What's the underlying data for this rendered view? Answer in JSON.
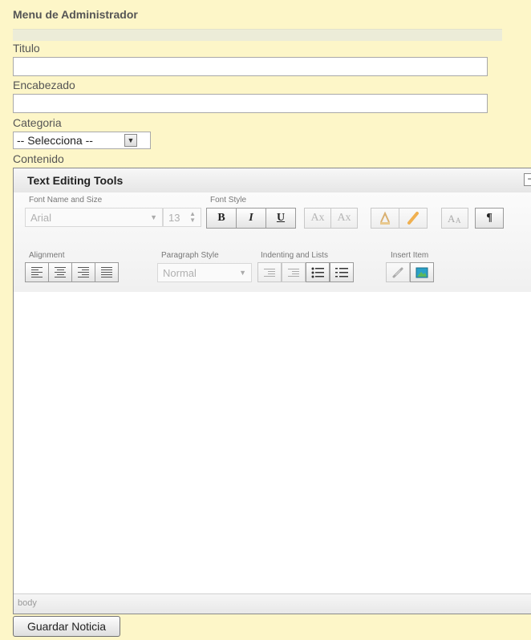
{
  "admin_menu": {
    "title": "Menu de Administrador"
  },
  "form": {
    "titulo_label": "Titulo",
    "titulo_value": "",
    "encabezado_label": "Encabezado",
    "encabezado_value": "",
    "categoria_label": "Categoria",
    "categoria_selected": "-- Selecciona --",
    "contenido_label": "Contenido",
    "submit_label": "Guardar Noticia"
  },
  "editor": {
    "title": "Text Editing Tools",
    "collapse_symbol": "−",
    "groups": {
      "font_name_size": "Font Name and Size",
      "font_style": "Font Style",
      "alignment": "Alignment",
      "paragraph_style": "Paragraph Style",
      "indenting_lists": "Indenting and Lists",
      "insert_item": "Insert Item"
    },
    "font_name": "Arial",
    "font_size": "13",
    "paragraph_style": "Normal",
    "buttons": {
      "bold": "B",
      "italic": "I",
      "underline": "U",
      "subscript": "Ax",
      "superscript": "Ax",
      "paragraph": "¶"
    },
    "status_path": "body"
  },
  "colors": {
    "page_background": "#fdf6c8",
    "toolbar_background": "#f0f0f0"
  }
}
